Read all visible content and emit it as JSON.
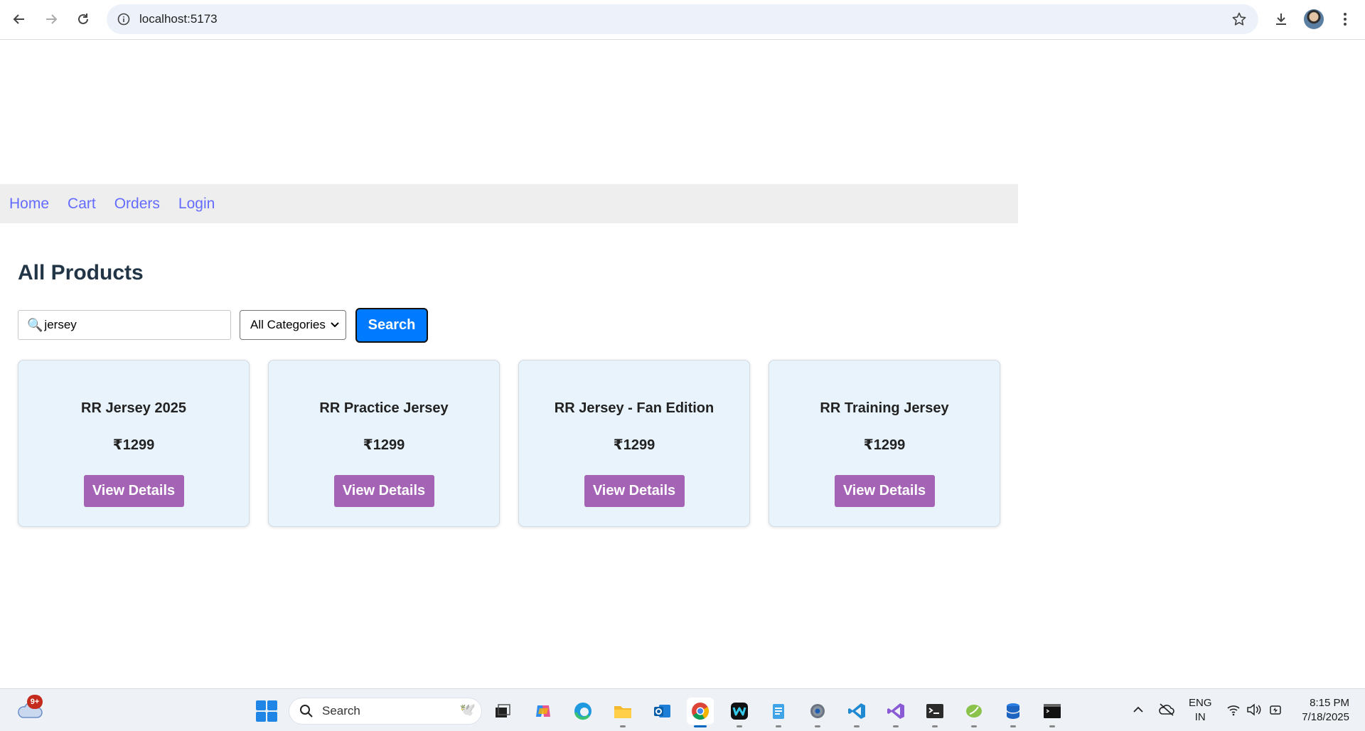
{
  "browser": {
    "url": "localhost:5173"
  },
  "navbar": {
    "links": [
      "Home",
      "Cart",
      "Orders",
      "Login"
    ]
  },
  "main": {
    "title": "All Products",
    "search": {
      "value": "jersey"
    },
    "category_select": {
      "selected": "All Categories"
    },
    "search_button": "Search",
    "products": [
      {
        "name": "RR Jersey 2025",
        "price": "₹1299",
        "button": "View Details"
      },
      {
        "name": "RR Practice Jersey",
        "price": "₹1299",
        "button": "View Details"
      },
      {
        "name": "RR Jersey - Fan Edition",
        "price": "₹1299",
        "button": "View Details"
      },
      {
        "name": "RR Training Jersey",
        "price": "₹1299",
        "button": "View Details"
      }
    ]
  },
  "taskbar": {
    "weather_badge": "9+",
    "search_label": "Search",
    "language": {
      "line1": "ENG",
      "line2": "IN"
    },
    "time": "8:15 PM",
    "date": "7/18/2025",
    "apps": [
      "task-view",
      "copilot",
      "edge",
      "file-explorer",
      "outlook",
      "chrome",
      "webex",
      "notepad",
      "settings",
      "vscode",
      "visual-studio",
      "terminal",
      "app-green",
      "app-blue",
      "command-prompt"
    ]
  },
  "colors": {
    "accent_link": "#646cff",
    "search_button": "#007bff",
    "view_details": "#a463b4",
    "card_bg": "#e8f3fc"
  }
}
